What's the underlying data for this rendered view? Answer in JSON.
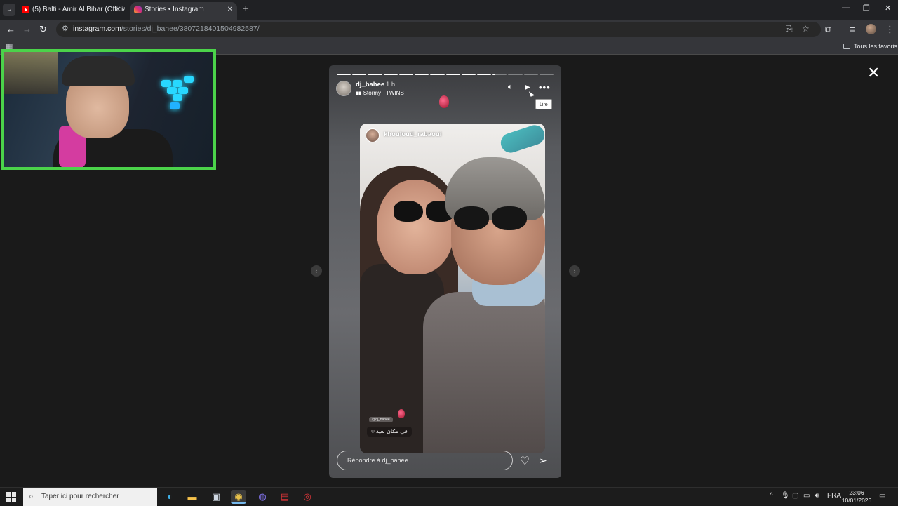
{
  "browser": {
    "tabs": [
      {
        "label": "(5) Balti - Amir Al Bihar (Official"
      },
      {
        "label": "Stories • Instagram"
      }
    ],
    "url_host": "instagram.com",
    "url_path": "/stories/dj_bahee/3807218401504982587/",
    "bookmarks_label": "Tous les favoris"
  },
  "story": {
    "progress_segments": 14,
    "progress_active_index": 10,
    "progress_active_fraction": 0.2,
    "username": "dj_bahee",
    "time": "1 h",
    "music": "Stormy · TWINS",
    "tooltip": "Lire",
    "shared_post_user": "khouloud_rabaoui",
    "mention_tag": "@dj_bahee",
    "location_tag": "في مكان بعيد",
    "reply_placeholder": "Répondre à dj_bahee..."
  },
  "taskbar": {
    "search_placeholder": "Taper ici pour rechercher",
    "language": "FRA",
    "time": "23:06",
    "date": "10/01/2026"
  },
  "icons": {
    "like": "heart-icon",
    "share": "send-icon",
    "close": "close-icon"
  },
  "colors": {
    "webcam_border": "#4bd34a",
    "instagram_bg": "#1a1a1a",
    "browser_frame": "#35363a"
  }
}
